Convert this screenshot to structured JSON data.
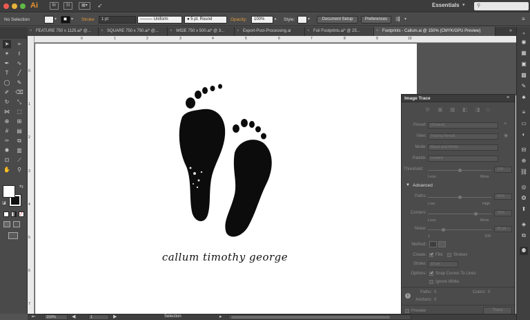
{
  "app": {
    "logo": "Ai",
    "workspace": "Essentials"
  },
  "control_bar": {
    "selection_label": "No Selection",
    "stroke_label": "Stroke",
    "stroke_weight": "1 pt",
    "stroke_profile": "Uniform",
    "brush": "5 pt. Round",
    "opacity_label": "Opacity:",
    "opacity_value": "100%",
    "style_label": "Style:",
    "document_setup": "Document Setup",
    "preferences": "Preferences"
  },
  "tabs": [
    {
      "label": "FEATURE 750 x 1125.ai* @..."
    },
    {
      "label": "SQUARE 750 x 750.ai* @..."
    },
    {
      "label": "WIDE 750 x 500.ai* @ 3..."
    },
    {
      "label": "Export-Post-Processing.ai"
    },
    {
      "label": "Foil Footprints.ai* @ 25..."
    },
    {
      "label": "Footprints - Callum.ai @ 150% (CMYK/GPU Preview)"
    }
  ],
  "ruler_top": [
    "0",
    "1",
    "2",
    "3",
    "4",
    "5",
    "6",
    "7",
    "8",
    "9",
    "10"
  ],
  "ruler_left": [
    "0",
    "1",
    "2",
    "3",
    "4",
    "5",
    "6",
    "7"
  ],
  "artwork": {
    "caption": "callum timothy george"
  },
  "image_trace": {
    "title": "Image Trace",
    "preset_label": "Preset:",
    "preset_value": "[Default]",
    "view_label": "View:",
    "view_value": "Tracing Result",
    "mode_label": "Mode:",
    "mode_value": "Black and White",
    "palette_label": "Palette:",
    "palette_value": "Limited",
    "threshold_label": "Threshold:",
    "threshold_value": "128",
    "threshold_less": "Less",
    "threshold_more": "More",
    "advanced_label": "Advanced",
    "paths_label": "Paths:",
    "paths_value": "50%",
    "paths_low": "Low",
    "paths_high": "High",
    "corners_label": "Corners:",
    "corners_value": "75%",
    "corners_less": "Less",
    "corners_more": "More",
    "noise_label": "Noise:",
    "noise_value": "25 px",
    "noise_min": "1",
    "noise_max": "100",
    "method_label": "Method:",
    "create_label": "Create:",
    "fills_label": "Fills",
    "strokes_label": "Strokes",
    "stroke_label": "Stroke:",
    "stroke_value": "10 px",
    "options_label": "Options:",
    "snap_label": "Snap Curves To Lines",
    "ignore_white_label": "Ignore White",
    "info_paths_label": "Paths:",
    "info_paths_value": "0",
    "info_colors_label": "Colors:",
    "info_colors_value": "0",
    "info_anchors_label": "Anchors:",
    "info_anchors_value": "0",
    "preview_label": "Preview",
    "trace_button": "Trace"
  },
  "status_bar": {
    "zoom": "150%",
    "artboard": "1",
    "tool": "Selection"
  }
}
